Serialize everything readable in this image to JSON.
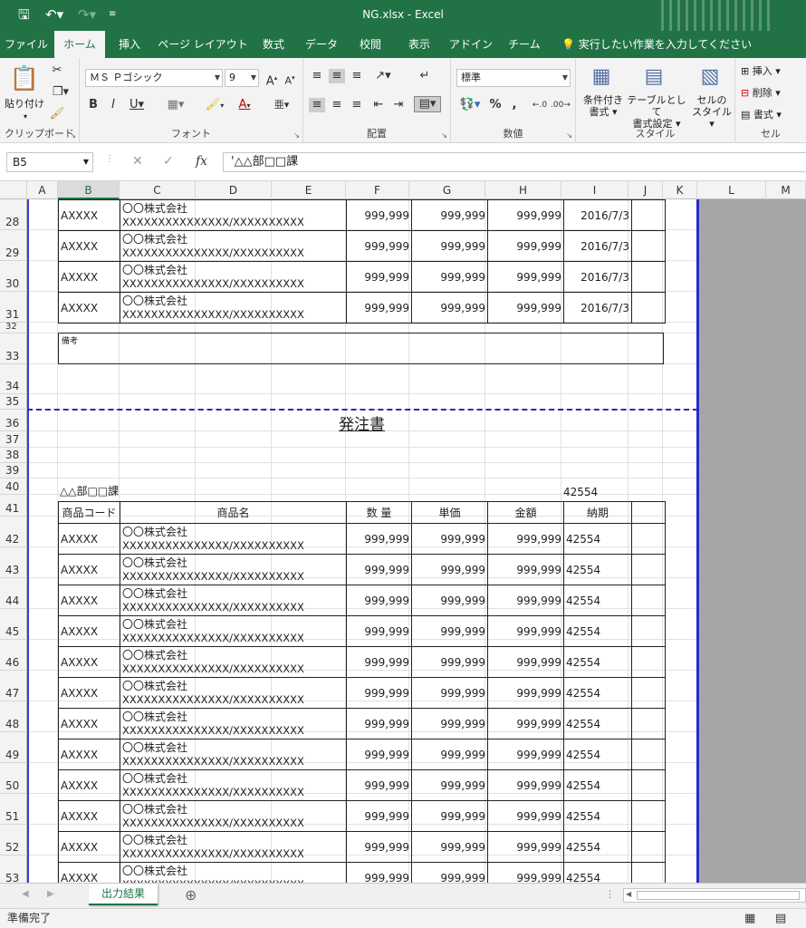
{
  "window": {
    "title": "NG.xlsx - Excel"
  },
  "qat": {
    "save_icon": "save-icon",
    "undo_icon": "undo-icon",
    "redo_icon": "redo-icon"
  },
  "tabs": [
    "ファイル",
    "ホーム",
    "挿入",
    "ページ レイアウト",
    "数式",
    "データ",
    "校閲",
    "表示",
    "アドイン",
    "チーム"
  ],
  "active_tab": "ホーム",
  "tellme": "実行したい作業を入力してください",
  "ribbon": {
    "clipboard": {
      "label": "クリップボード",
      "paste": "貼り付け"
    },
    "font": {
      "label": "フォント",
      "name": "ＭＳ Ｐゴシック",
      "size": "9"
    },
    "alignment": {
      "label": "配置"
    },
    "number": {
      "label": "数値",
      "format": "標準"
    },
    "styles": {
      "label": "スタイル",
      "cond1": "条件付き",
      "cond2": "書式",
      "table1": "テーブルとして",
      "table2": "書式設定",
      "cell1": "セルの",
      "cell2": "スタイル"
    },
    "cells": {
      "label": "セル",
      "insert": "挿入",
      "delete": "削除",
      "format": "書式"
    }
  },
  "formula_bar": {
    "name_box": "B5",
    "fx": "fx",
    "content": "'△△部□□課"
  },
  "columns": [
    "A",
    "B",
    "C",
    "D",
    "E",
    "F",
    "G",
    "H",
    "I",
    "J",
    "K",
    "L",
    "M"
  ],
  "rows": [
    "28",
    "29",
    "30",
    "31",
    "32",
    "33",
    "34",
    "35",
    "36",
    "37",
    "38",
    "39",
    "40",
    "41",
    "42",
    "43",
    "44",
    "45",
    "46",
    "47",
    "48",
    "49",
    "50",
    "51",
    "52",
    "53"
  ],
  "sheet": {
    "top_rows": [
      {
        "code": "AXXXX",
        "name1": "〇〇株式会社",
        "name2": "XXXXXXXXXXXXXXX/XXXXXXXXXX",
        "qty": "999,999",
        "price": "999,999",
        "amount": "999,999",
        "date": "2016/7/3"
      },
      {
        "code": "AXXXX",
        "name1": "〇〇株式会社",
        "name2": "XXXXXXXXXXXXXXX/XXXXXXXXXX",
        "qty": "999,999",
        "price": "999,999",
        "amount": "999,999",
        "date": "2016/7/3"
      },
      {
        "code": "AXXXX",
        "name1": "〇〇株式会社",
        "name2": "XXXXXXXXXXXXXXX/XXXXXXXXXX",
        "qty": "999,999",
        "price": "999,999",
        "amount": "999,999",
        "date": "2016/7/3"
      },
      {
        "code": "AXXXX",
        "name1": "〇〇株式会社",
        "name2": "XXXXXXXXXXXXXXX/XXXXXXXXXX",
        "qty": "999,999",
        "price": "999,999",
        "amount": "999,999",
        "date": "2016/7/3"
      }
    ],
    "remarks_label": "備考",
    "doc_title": "発注書",
    "department": "△△部□□課",
    "doc_date": "42554",
    "headers": {
      "code": "商品コード",
      "name": "商品名",
      "qty": "数 量",
      "price": "単価",
      "amount": "金額",
      "due": "納期"
    },
    "rows": [
      {
        "code": "AXXXX",
        "name1": "〇〇株式会社",
        "name2": "XXXXXXXXXXXXXXX/XXXXXXXXXX",
        "qty": "999,999",
        "price": "999,999",
        "amount": "999,999",
        "due": "42554"
      },
      {
        "code": "AXXXX",
        "name1": "〇〇株式会社",
        "name2": "XXXXXXXXXXXXXXX/XXXXXXXXXX",
        "qty": "999,999",
        "price": "999,999",
        "amount": "999,999",
        "due": "42554"
      },
      {
        "code": "AXXXX",
        "name1": "〇〇株式会社",
        "name2": "XXXXXXXXXXXXXXX/XXXXXXXXXX",
        "qty": "999,999",
        "price": "999,999",
        "amount": "999,999",
        "due": "42554"
      },
      {
        "code": "AXXXX",
        "name1": "〇〇株式会社",
        "name2": "XXXXXXXXXXXXXXX/XXXXXXXXXX",
        "qty": "999,999",
        "price": "999,999",
        "amount": "999,999",
        "due": "42554"
      },
      {
        "code": "AXXXX",
        "name1": "〇〇株式会社",
        "name2": "XXXXXXXXXXXXXXX/XXXXXXXXXX",
        "qty": "999,999",
        "price": "999,999",
        "amount": "999,999",
        "due": "42554"
      },
      {
        "code": "AXXXX",
        "name1": "〇〇株式会社",
        "name2": "XXXXXXXXXXXXXXX/XXXXXXXXXX",
        "qty": "999,999",
        "price": "999,999",
        "amount": "999,999",
        "due": "42554"
      },
      {
        "code": "AXXXX",
        "name1": "〇〇株式会社",
        "name2": "XXXXXXXXXXXXXXX/XXXXXXXXXX",
        "qty": "999,999",
        "price": "999,999",
        "amount": "999,999",
        "due": "42554"
      },
      {
        "code": "AXXXX",
        "name1": "〇〇株式会社",
        "name2": "XXXXXXXXXXXXXXX/XXXXXXXXXX",
        "qty": "999,999",
        "price": "999,999",
        "amount": "999,999",
        "due": "42554"
      },
      {
        "code": "AXXXX",
        "name1": "〇〇株式会社",
        "name2": "XXXXXXXXXXXXXXX/XXXXXXXXXX",
        "qty": "999,999",
        "price": "999,999",
        "amount": "999,999",
        "due": "42554"
      },
      {
        "code": "AXXXX",
        "name1": "〇〇株式会社",
        "name2": "XXXXXXXXXXXXXXX/XXXXXXXXXX",
        "qty": "999,999",
        "price": "999,999",
        "amount": "999,999",
        "due": "42554"
      },
      {
        "code": "AXXXX",
        "name1": "〇〇株式会社",
        "name2": "XXXXXXXXXXXXXXX/XXXXXXXXXX",
        "qty": "999,999",
        "price": "999,999",
        "amount": "999,999",
        "due": "42554"
      },
      {
        "code": "AXXXX",
        "name1": "〇〇株式会社",
        "name2": "XXXXXXXXXXXXXXX/XXXXXXXXXX",
        "qty": "999,999",
        "price": "999,999",
        "amount": "999,999",
        "due": "42554"
      }
    ]
  },
  "sheet_tab": "出力結果",
  "status": "準備完了",
  "colors": {
    "excel_green": "#217346",
    "page_border": "#2929c8",
    "outside_print": "#a6a6a6"
  }
}
